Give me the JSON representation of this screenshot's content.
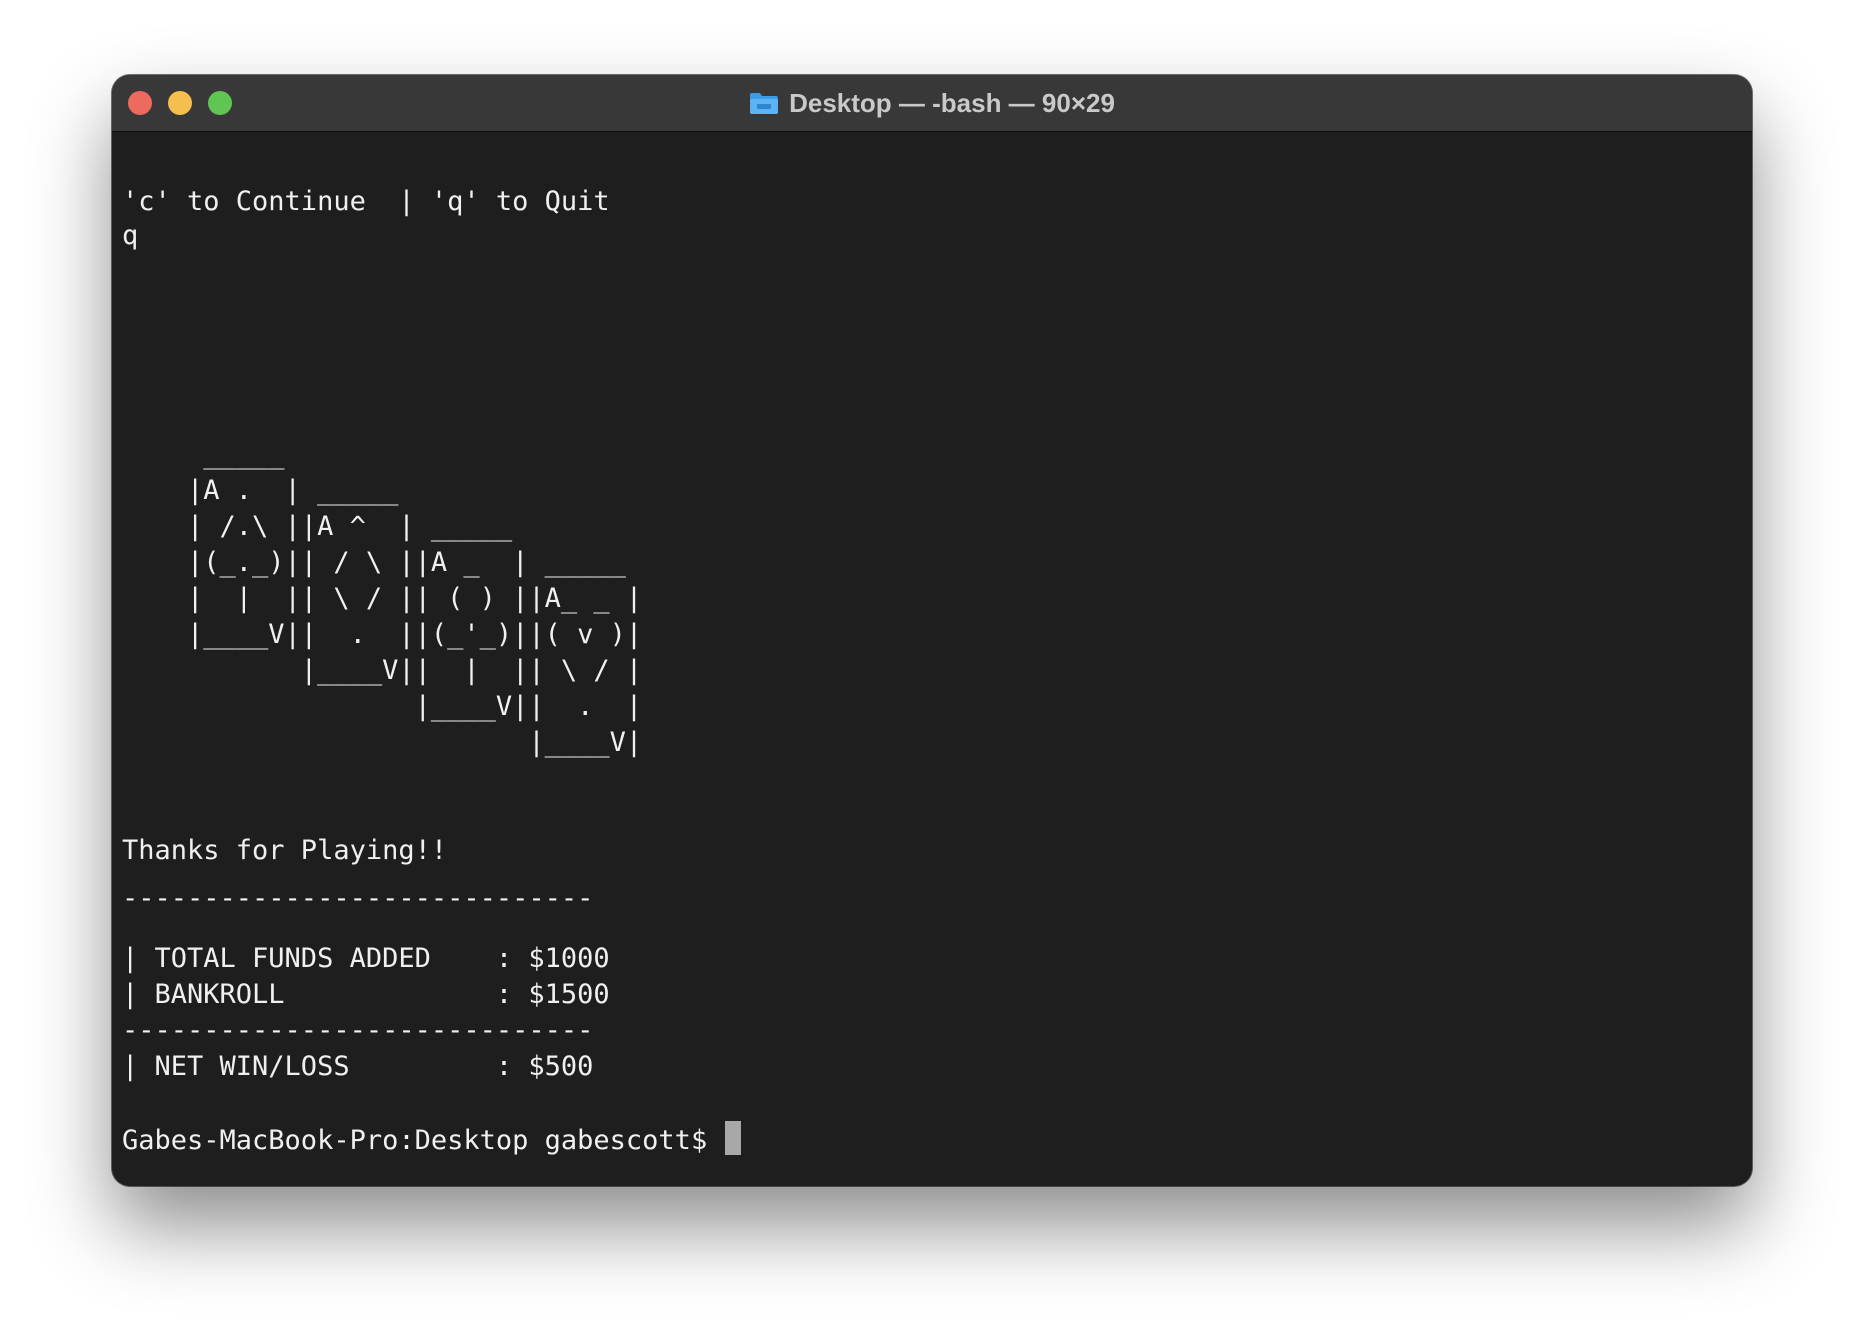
{
  "window": {
    "title": "Desktop — -bash — 90×29",
    "title_icon": "folder-icon"
  },
  "terminal": {
    "prompt_hint": "'c' to Continue  | 'q' to Quit",
    "typed_input": "q",
    "cards_art": [
      "     _____",
      "    |A .  | _____",
      "    | /.\\ ||A ^  | _____",
      "    |(_._)|| / \\ ||A _  | _____",
      "    |  |  || \\ / || ( ) ||A_ _ |",
      "    |____V||  .  ||(_'_)||( v )|",
      "           |____V||  |  || \\ / |",
      "                  |____V||  .  |",
      "                         |____V|"
    ],
    "thanks": "Thanks for Playing!!",
    "divider": "-----------------------------",
    "summary": {
      "total_funds_line": "| TOTAL FUNDS ADDED    : $1000",
      "bankroll_line": "| BANKROLL             : $1500",
      "net_line": "| NET WIN/LOSS         : $500"
    },
    "prompt": "Gabes-MacBook-Pro:Desktop gabescott$ "
  },
  "colors": {
    "terminal_bg": "#1e1e1e",
    "titlebar_bg": "#383838",
    "text": "#f0f0f0",
    "close": "#ec6a5e",
    "minimize": "#f4bf4f",
    "maximize": "#61c554"
  }
}
